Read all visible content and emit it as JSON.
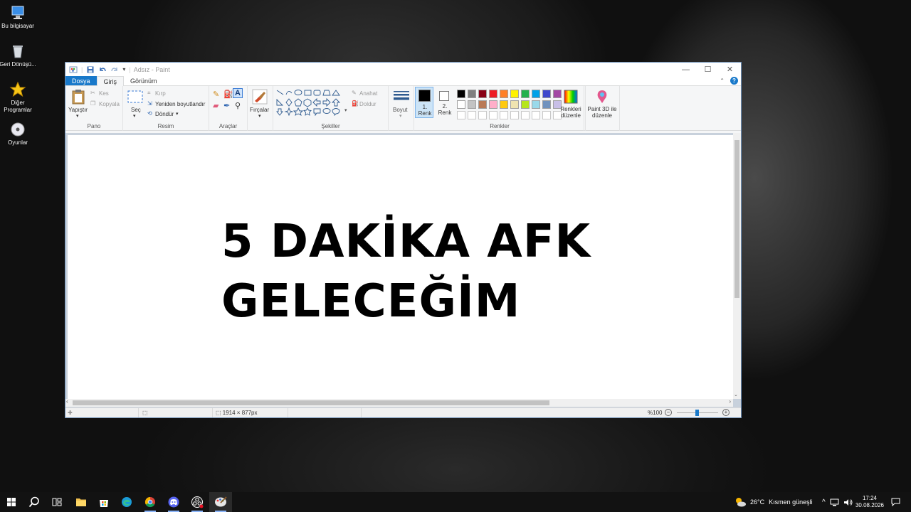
{
  "desktop": {
    "icons": [
      {
        "label": "Bu bilgisayar",
        "icon": "computer-icon"
      },
      {
        "label": "Geri Dönüşü...",
        "icon": "recycle-bin-icon"
      },
      {
        "label": "Diğer Programlar",
        "icon": "star-icon"
      },
      {
        "label": "Oyunlar",
        "icon": "disc-icon"
      }
    ]
  },
  "window": {
    "title": "Adsız - Paint",
    "tabs": [
      {
        "label": "Dosya"
      },
      {
        "label": "Giriş"
      },
      {
        "label": "Görünüm"
      }
    ],
    "ribbon": {
      "clipboard": {
        "paste": "Yapıştır",
        "cut": "Kes",
        "copy": "Kopyala",
        "group": "Pano"
      },
      "image": {
        "select": "Seç",
        "crop": "Kırp",
        "resize": "Yeniden boyutlandır",
        "rotate": "Döndür",
        "group": "Resim"
      },
      "tools": {
        "group": "Araçlar"
      },
      "brushes": {
        "label": "Fırçalar"
      },
      "shapes": {
        "outline": "Anahat",
        "fill": "Doldur",
        "group": "Şekiller"
      },
      "size": {
        "label": "Boyut"
      },
      "colors": {
        "color1": "1. Renk",
        "color2": "2. Renk",
        "edit": "Renkleri düzenle",
        "group": "Renkler",
        "palette_row1": [
          "#000000",
          "#7f7f7f",
          "#880015",
          "#ed1c24",
          "#ff7f27",
          "#fff200",
          "#22b14c",
          "#00a2e8",
          "#3f48cc",
          "#a349a4"
        ],
        "palette_row2": [
          "#ffffff",
          "#c3c3c3",
          "#b97a57",
          "#ffaec9",
          "#ffc90e",
          "#efe4b0",
          "#b5e61d",
          "#99d9ea",
          "#7092be",
          "#c8bfe7"
        ]
      },
      "paint3d": {
        "label": "Paint 3D ile düzenle"
      }
    },
    "canvas": {
      "line1": "5 DAKİKA AFK",
      "line2": "GELECEĞİM"
    },
    "status": {
      "dimensions": "1914 × 877px",
      "zoom": "%100"
    }
  },
  "taskbar": {
    "weather": {
      "temp": "26°C",
      "condition": "Kısmen güneşli"
    },
    "clock": {
      "time": "17:24",
      "date": "30.08.2026"
    }
  }
}
